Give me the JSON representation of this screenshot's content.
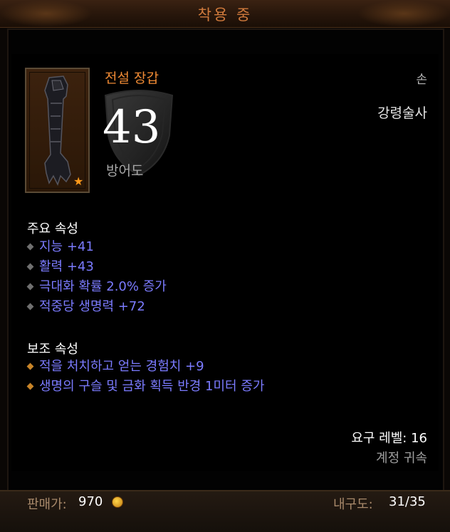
{
  "header": {
    "title": "착용 중"
  },
  "item": {
    "name": "전설 장갑",
    "slot": "손",
    "class": "강령술사",
    "armor_value": "43",
    "armor_label": "방어도",
    "icon": "gauntlet-icon",
    "badge_icon": "star-icon",
    "name_color": "#ef8a34"
  },
  "primary": {
    "title": "주요 속성",
    "stats": [
      "지능 +41",
      "활력 +43",
      "극대화 확률 2.0% 증가",
      "적중당 생명력 +72"
    ]
  },
  "secondary": {
    "title": "보조 속성",
    "stats": [
      "적을 처치하고 얻는 경험치 +9",
      "생명의 구슬 및 금화 획득 반경 1미터 증가"
    ]
  },
  "requirements": {
    "level": "요구 레벨: 16",
    "bound": "계정 귀속"
  },
  "footer": {
    "sell_label": "판매가:",
    "sell_value": "970",
    "durability_label": "내구도:",
    "durability_value": "31/35"
  },
  "colors": {
    "affix": "#7b7bff",
    "accent": "#d07a3c"
  }
}
